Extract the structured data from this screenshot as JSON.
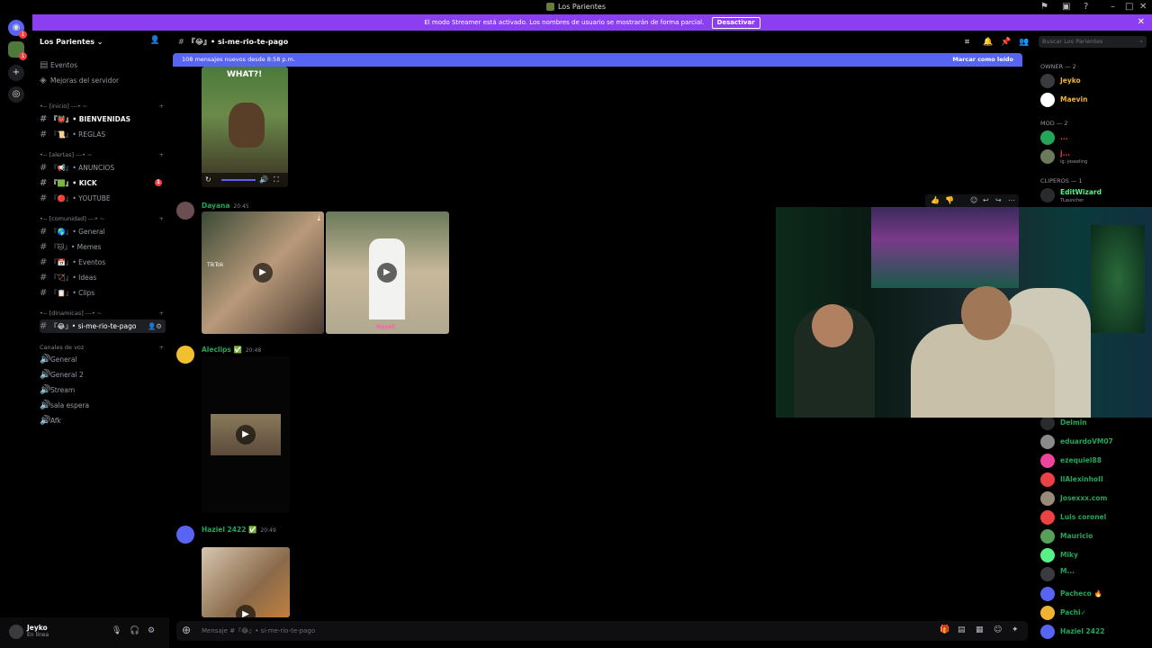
{
  "window": {
    "title": "Los Parientes"
  },
  "banner": {
    "text": "El modo Streamer está activado. Los nombres de usuario se mostrarán de forma parcial.",
    "button": "Desactivar"
  },
  "guilds": {
    "dm_badge": "1",
    "server_badge": "1"
  },
  "server": {
    "name": "Los Parientes"
  },
  "sidebar": {
    "top_items": [
      "Eventos",
      "Mejoras del servidor"
    ],
    "categories": [
      {
        "label": "•-- [inicio] ---• ~"
      },
      {
        "label": "•-- [alertas] ---• ~"
      },
      {
        "label": "•-- [comunidad] ---• ~"
      },
      {
        "label": "•-- [dinamicas] ---• ~"
      }
    ],
    "channels": [
      {
        "label": "『👹』• BIENVENIDAS"
      },
      {
        "label": "『📜』• REGLAS"
      },
      {
        "label": "『📢』• ANUNCIOS"
      },
      {
        "label": "『🟩』• KICK",
        "badge": "1"
      },
      {
        "label": "『🔴』• YOUTUBE"
      },
      {
        "label": "『🌎』• General"
      },
      {
        "label": "『🐱』• Memes"
      },
      {
        "label": "『📅』• Eventos"
      },
      {
        "label": "『🏹』• Ideas"
      },
      {
        "label": "『📋』• Clips"
      },
      {
        "label": "『😂』• si-me-rio-te-pago"
      }
    ],
    "voice_category": "Canales de voz",
    "voice": [
      "General",
      "General 2",
      "Stream",
      "sala espera",
      "Afk"
    ]
  },
  "user": {
    "name": "Jeyko",
    "status": "En línea"
  },
  "channel": {
    "name": "『😂』• si-me-rio-te-pago"
  },
  "newbar": {
    "text": "108 mensajes nuevos desde 8:58 p.m.",
    "action": "Marcar como leído"
  },
  "search": {
    "placeholder": "Buscar Los Parientes"
  },
  "messages": [
    {
      "author": "Dayana",
      "time": "20:45"
    },
    {
      "author": "Aleclips",
      "time": "20:48"
    },
    {
      "author": "Haziel 2422",
      "time": "20:49"
    }
  ],
  "media_text": {
    "what": "WHAT?!",
    "tiktok": "TikTok",
    "nayeli": "Nayeli"
  },
  "composer": {
    "placeholder": "Mensaje #『😂』• si-me-rio-te-pago"
  },
  "members": {
    "owner_label": "OWNER — 2",
    "owners": [
      "Jeyko",
      "Maevin"
    ],
    "mod_label": "MOD — 2",
    "mods": [
      {
        "name": "...",
        "sub": ""
      },
      {
        "name": "j...",
        "sub": "ig: joseeling"
      }
    ],
    "clip_label": "CLIPEROS — 1",
    "clippers": [
      {
        "name": "EditWizard",
        "sub": "TLauncher"
      }
    ],
    "online": [
      "Delmin",
      "eduardoVM07",
      "ezequiel88",
      "IlAlexinhoII",
      "Josexxx.com",
      "Luis coronel",
      "Mauricio",
      "Miky",
      "M...",
      "Pacheco 🔥",
      "Pachi✓",
      "Haziel 2422"
    ]
  }
}
